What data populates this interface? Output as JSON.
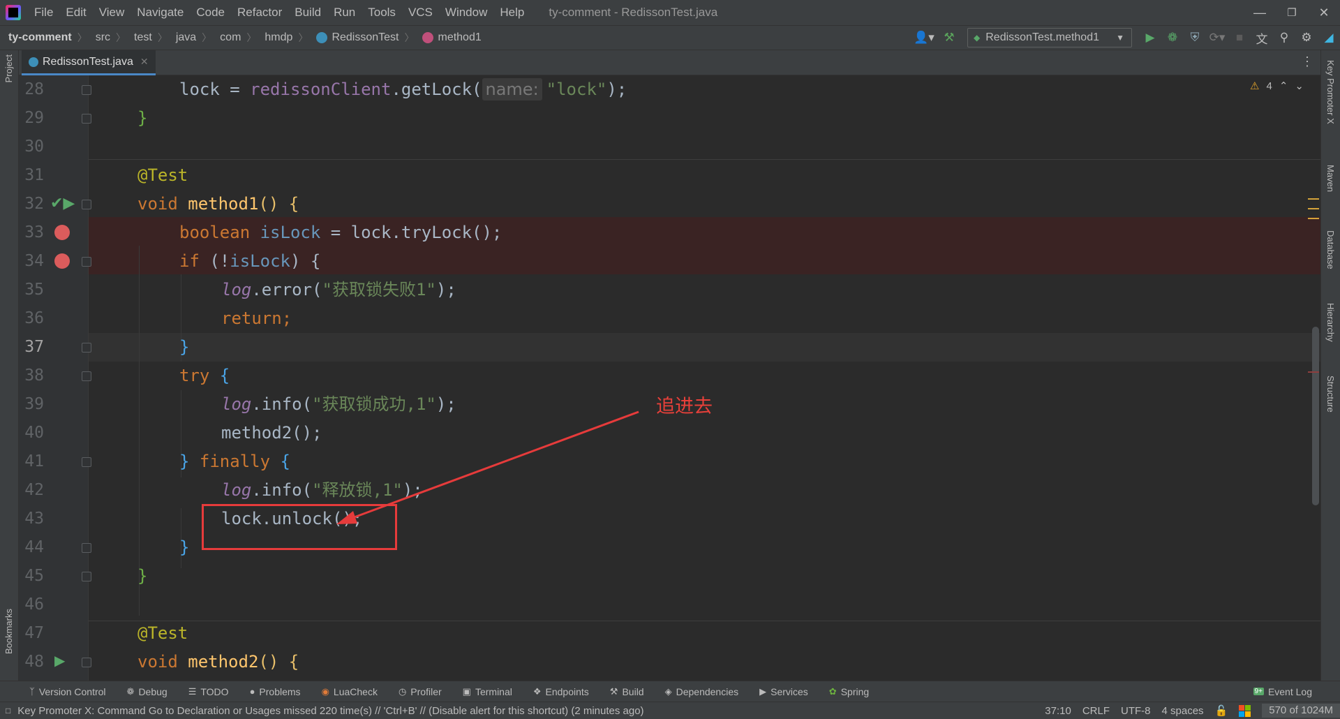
{
  "menubar": {
    "items": [
      "File",
      "Edit",
      "View",
      "Navigate",
      "Code",
      "Refactor",
      "Build",
      "Run",
      "Tools",
      "VCS",
      "Window",
      "Help"
    ],
    "window_title": "ty-comment - RedissonTest.java"
  },
  "breadcrumb": [
    "ty-comment",
    "src",
    "test",
    "java",
    "com",
    "hmdp",
    "RedissonTest",
    "method1"
  ],
  "toolbar": {
    "run_config": "RedissonTest.method1"
  },
  "tab": {
    "label": "RedissonTest.java"
  },
  "inspections": {
    "warnings": "4"
  },
  "code": {
    "l28": {
      "ln": "28",
      "pre": "lock = ",
      "obj": "redissonClient",
      "call": ".getLock(",
      "hint": "name:",
      "str": "\"lock\"",
      "end": ");"
    },
    "l29": {
      "ln": "29",
      "text": "}"
    },
    "l30": {
      "ln": "30"
    },
    "l31": {
      "ln": "31",
      "ann": "@Test"
    },
    "l32": {
      "ln": "32",
      "kw": "void ",
      "fn": "method1",
      "rest": "() {"
    },
    "l33": {
      "ln": "33",
      "kw": "boolean ",
      "var": "isLock",
      "rest": " = lock.tryLock();"
    },
    "l34": {
      "ln": "34",
      "kw": "if ",
      "pre": "(!",
      "var": "isLock",
      "rest": ") {"
    },
    "l35": {
      "ln": "35",
      "log": "log",
      "mid": ".error(",
      "str": "\"获取锁失败1\"",
      "end": ");"
    },
    "l36": {
      "ln": "36",
      "kw": "return",
      "end": ";"
    },
    "l37": {
      "ln": "37",
      "text": "}"
    },
    "l38": {
      "ln": "38",
      "kw": "try ",
      "rest": "{"
    },
    "l39": {
      "ln": "39",
      "log": "log",
      "mid": ".info(",
      "str": "\"获取锁成功,1\"",
      "end": ");"
    },
    "l40": {
      "ln": "40",
      "text": "method2();"
    },
    "l41": {
      "ln": "41",
      "pre": "} ",
      "kw": "finally ",
      "rest": "{"
    },
    "l42": {
      "ln": "42",
      "log": "log",
      "mid": ".info(",
      "str": "\"释放锁,1\"",
      "end": ");"
    },
    "l43": {
      "ln": "43",
      "text": "lock.unlock();"
    },
    "l44": {
      "ln": "44",
      "text": "}"
    },
    "l45": {
      "ln": "45",
      "text": "}"
    },
    "l46": {
      "ln": "46"
    },
    "l47": {
      "ln": "47",
      "ann": "@Test"
    },
    "l48": {
      "ln": "48",
      "kw": "void ",
      "fn": "method2",
      "rest": "() {"
    }
  },
  "annotation": {
    "text": "追进去",
    "color": "#e8403a"
  },
  "left_strip": {
    "project": "Project",
    "bookmarks": "Bookmarks"
  },
  "right_strip": [
    "Key Promoter X",
    "Maven",
    "Database",
    "Hierarchy",
    "Structure"
  ],
  "bottom_tools": [
    "Version Control",
    "Debug",
    "TODO",
    "Problems",
    "LuaCheck",
    "Profiler",
    "Terminal",
    "Endpoints",
    "Build",
    "Dependencies",
    "Services",
    "Spring"
  ],
  "event_log": {
    "badge": "9+",
    "label": "Event Log"
  },
  "status": {
    "message": "Key Promoter X: Command Go to Declaration or Usages missed 220 time(s) // 'Ctrl+B' // (Disable alert for this shortcut) (2 minutes ago)",
    "position": "37:10",
    "line_sep": "CRLF",
    "encoding": "UTF-8",
    "indent": "4 spaces",
    "memory": "570 of 1024M"
  }
}
